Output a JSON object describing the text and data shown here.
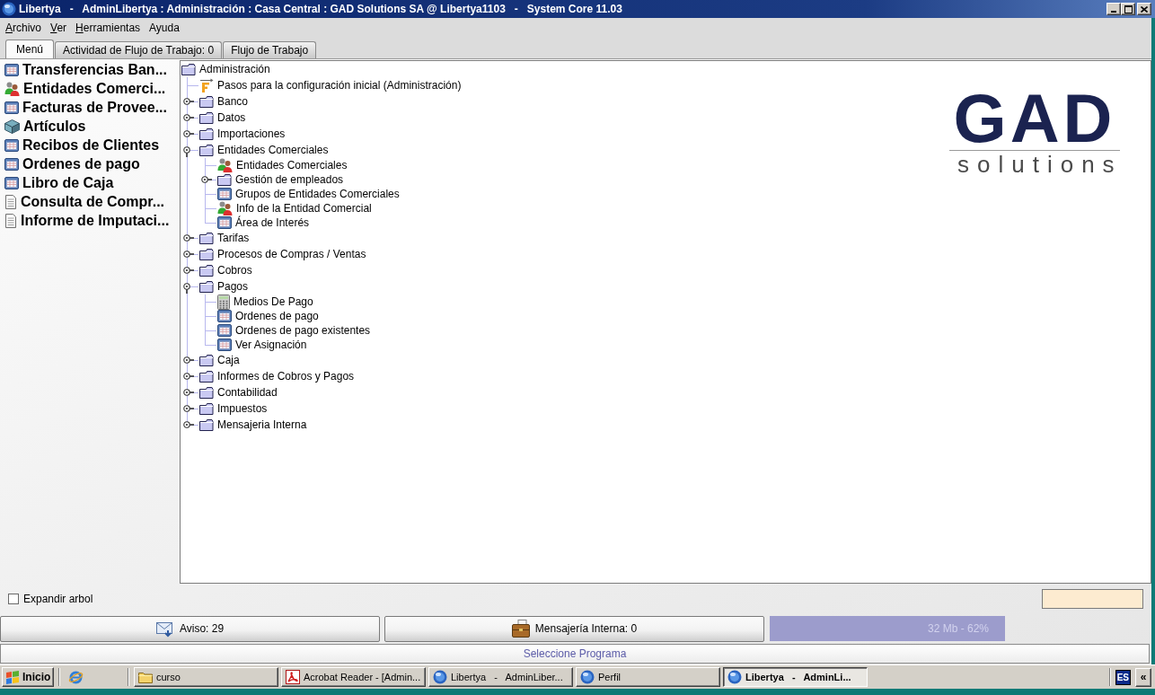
{
  "window": {
    "title": "Libertya   -   AdminLibertya : Administración : Casa Central : GAD Solutions SA @ Libertya1103   -   System Core 11.03"
  },
  "menu": [
    {
      "label": "Archivo",
      "mnemonic": true
    },
    {
      "label": "Ver",
      "mnemonic": true
    },
    {
      "label": "Herramientas",
      "mnemonic": true
    },
    {
      "label": "Ayuda",
      "mnemonic": false
    }
  ],
  "tabs": [
    {
      "label": "Menú",
      "selected": true
    },
    {
      "label": "Actividad de Flujo de Trabajo: 0",
      "selected": false
    },
    {
      "label": "Flujo de Trabajo",
      "selected": false
    }
  ],
  "sidebar": {
    "items": [
      {
        "label": "Transferencias Ban...",
        "kind": "window"
      },
      {
        "label": "Entidades Comerci...",
        "kind": "people"
      },
      {
        "label": "Facturas de Provee...",
        "kind": "window"
      },
      {
        "label": "Artículos",
        "kind": "cube"
      },
      {
        "label": "Recibos de Clientes",
        "kind": "window"
      },
      {
        "label": "Ordenes de pago",
        "kind": "window"
      },
      {
        "label": "Libro de Caja",
        "kind": "window"
      },
      {
        "label": "Consulta de Compr...",
        "kind": "document"
      },
      {
        "label": "Informe de Imputaci...",
        "kind": "document"
      }
    ]
  },
  "tree": {
    "label": "Administración",
    "kind": "folder",
    "children": [
      {
        "label": "Pasos para la configuración inicial (Administración)",
        "kind": "workflow"
      },
      {
        "label": "Banco",
        "kind": "folder",
        "expanded": false
      },
      {
        "label": "Datos",
        "kind": "folder",
        "expanded": false
      },
      {
        "label": "Importaciones",
        "kind": "folder",
        "expanded": false
      },
      {
        "label": "Entidades Comerciales",
        "kind": "folder",
        "expanded": true,
        "children": [
          {
            "label": "Entidades Comerciales",
            "kind": "people"
          },
          {
            "label": "Gestión de empleados",
            "kind": "folder",
            "expanded": false
          },
          {
            "label": "Grupos de Entidades Comerciales",
            "kind": "window"
          },
          {
            "label": "Info de la Entidad Comercial",
            "kind": "people"
          },
          {
            "label": "Área de Interés",
            "kind": "window"
          }
        ]
      },
      {
        "label": "Tarifas",
        "kind": "folder",
        "expanded": false
      },
      {
        "label": "Procesos de Compras / Ventas",
        "kind": "folder",
        "expanded": false
      },
      {
        "label": "Cobros",
        "kind": "folder",
        "expanded": false
      },
      {
        "label": "Pagos",
        "kind": "folder",
        "expanded": true,
        "children": [
          {
            "label": "Medios De Pago",
            "kind": "calculator"
          },
          {
            "label": "Ordenes de pago",
            "kind": "window"
          },
          {
            "label": "Ordenes de pago existentes",
            "kind": "window"
          },
          {
            "label": "Ver Asignación",
            "kind": "window"
          }
        ]
      },
      {
        "label": "Caja",
        "kind": "folder",
        "expanded": false
      },
      {
        "label": "Informes de Cobros y Pagos",
        "kind": "folder",
        "expanded": false
      },
      {
        "label": "Contabilidad",
        "kind": "folder",
        "expanded": false
      },
      {
        "label": "Impuestos",
        "kind": "folder",
        "expanded": false
      },
      {
        "label": "Mensajeria Interna",
        "kind": "folder",
        "expanded": false
      }
    ]
  },
  "logo": {
    "wordmark": "GAD",
    "tagline": "solutions"
  },
  "expand_tree": {
    "label": "Expandir arbol",
    "checked": false
  },
  "status_buttons": [
    {
      "kind": "notices",
      "label": "Aviso: 29"
    },
    {
      "kind": "messages",
      "label": "Mensajería Interna: 0"
    }
  ],
  "memory": {
    "text": "32 Mb - 62%"
  },
  "status_bar": {
    "message": "Seleccione Programa"
  },
  "taskbar": {
    "start": "Inicio",
    "tasks": [
      {
        "label": "curso",
        "kind": "folder",
        "selected": false
      },
      {
        "label": "Acrobat Reader - [Admin...",
        "kind": "pdf",
        "selected": false
      },
      {
        "label": "Libertya   -   AdminLiber...",
        "kind": "app",
        "selected": false
      },
      {
        "label": "Perfil",
        "kind": "app",
        "selected": false
      },
      {
        "label": "Libertya   -   AdminLi...",
        "kind": "app",
        "selected": true
      }
    ],
    "language": "ES",
    "tray_toggle": "«"
  }
}
